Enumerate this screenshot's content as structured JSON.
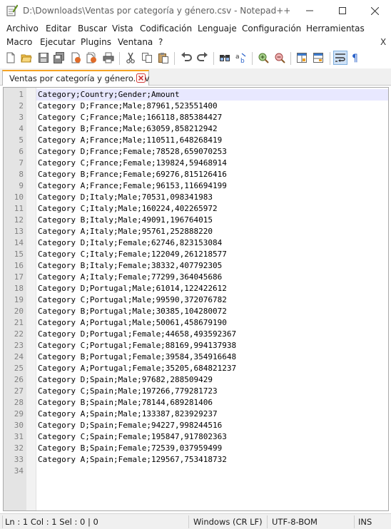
{
  "window": {
    "title": "D:\\Downloads\\Ventas por categoría y género.csv - Notepad++",
    "min_icon": "minimize-icon",
    "max_icon": "maximize-icon",
    "close_icon": "close-icon"
  },
  "menu": {
    "items": [
      "Archivo",
      "Editar",
      "Buscar",
      "Vista",
      "Codificación",
      "Lenguaje",
      "Configuración",
      "Herramientas",
      "Macro",
      "Ejecutar",
      "Plugins",
      "Ventana",
      "?"
    ],
    "doc_close": "X"
  },
  "toolbar": {
    "icons": [
      "new-file-icon",
      "open-file-icon",
      "save-icon",
      "save-all-icon",
      "close-icon",
      "close-all-icon",
      "print-icon",
      "cut-icon",
      "copy-icon",
      "paste-icon",
      "undo-icon",
      "redo-icon",
      "find-icon",
      "replace-icon",
      "zoom-in-icon",
      "zoom-out-icon",
      "sync-vertical-icon",
      "sync-horizontal-icon",
      "word-wrap-icon",
      "show-all-characters-icon"
    ],
    "active_icon": "word-wrap-icon"
  },
  "tab": {
    "label": "Ventas por categoría y género.csv",
    "accent_color": "#f5a323"
  },
  "editor": {
    "lines": [
      "Category;Country;Gender;Amount",
      "Category D;France;Male;87961,523551400",
      "Category C;France;Male;166118,885384427",
      "Category B;France;Male;63059,858212942",
      "Category A;France;Male;110511,648268419",
      "Category D;France;Female;78528,659070253",
      "Category C;France;Female;139824,59468914",
      "Category B;France;Female;69276,815126416",
      "Category A;France;Female;96153,116694199",
      "Category D;Italy;Male;70531,098341983",
      "Category C;Italy;Male;160224,402265972",
      "Category B;Italy;Male;49091,196764015",
      "Category A;Italy;Male;95761,252888220",
      "Category D;Italy;Female;62746,823153084",
      "Category C;Italy;Female;122049,261218577",
      "Category B;Italy;Female;38332,407792305",
      "Category A;Italy;Female;77299,364045686",
      "Category D;Portugal;Male;61014,122422612",
      "Category C;Portugal;Male;99590,372076782",
      "Category B;Portugal;Male;30385,104280072",
      "Category A;Portugal;Male;50061,458679190",
      "Category D;Portugal;Female;44658,493592367",
      "Category C;Portugal;Female;88169,994137938",
      "Category B;Portugal;Female;39584,354916648",
      "Category A;Portugal;Female;35205,684821237",
      "Category D;Spain;Male;97682,288509429",
      "Category C;Spain;Male;197266,779281723",
      "Category B;Spain;Male;78144,689281406",
      "Category A;Spain;Male;133387,823929237",
      "Category D;Spain;Female;94227,998244516",
      "Category C;Spain;Female;195847,917802363",
      "Category B;Spain;Female;72539,037959499",
      "Category A;Spain;Female;129567,753418732",
      ""
    ]
  },
  "status": {
    "position": "Ln : 1    Col : 1    Sel : 0 | 0",
    "eol": "Windows (CR LF)",
    "encoding": "UTF-8-BOM",
    "mode": "INS"
  }
}
